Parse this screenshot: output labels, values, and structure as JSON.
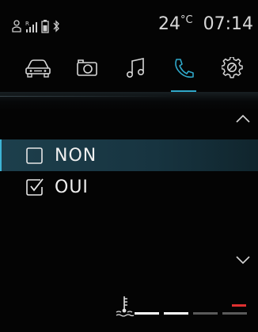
{
  "status": {
    "icons": [
      "user-icon",
      "signal-strength-icon",
      "battery-icon",
      "bluetooth-icon"
    ],
    "temperature_value": "24",
    "temperature_unit": "°C",
    "time": "07:14"
  },
  "tabs": [
    {
      "icon": "car-icon",
      "active": false
    },
    {
      "icon": "camera-icon",
      "active": false
    },
    {
      "icon": "music-note-icon",
      "active": false
    },
    {
      "icon": "phone-icon",
      "active": true
    },
    {
      "icon": "settings-gear-icon",
      "active": false
    }
  ],
  "options": [
    {
      "label": "NON",
      "checked": false,
      "selected": true
    },
    {
      "label": "OUI",
      "checked": true,
      "selected": false
    }
  ],
  "coolant_gauge": {
    "icon": "coolant-temperature-icon",
    "segments_lit": 2,
    "segments_total": 4,
    "colors": {
      "lit": "#ffffff",
      "unlit": "#5a5a5a",
      "warning": "#e03030"
    }
  },
  "colors": {
    "accent": "#2fa7c8",
    "selected_row": "#1d3f4c",
    "background": "#040404"
  }
}
